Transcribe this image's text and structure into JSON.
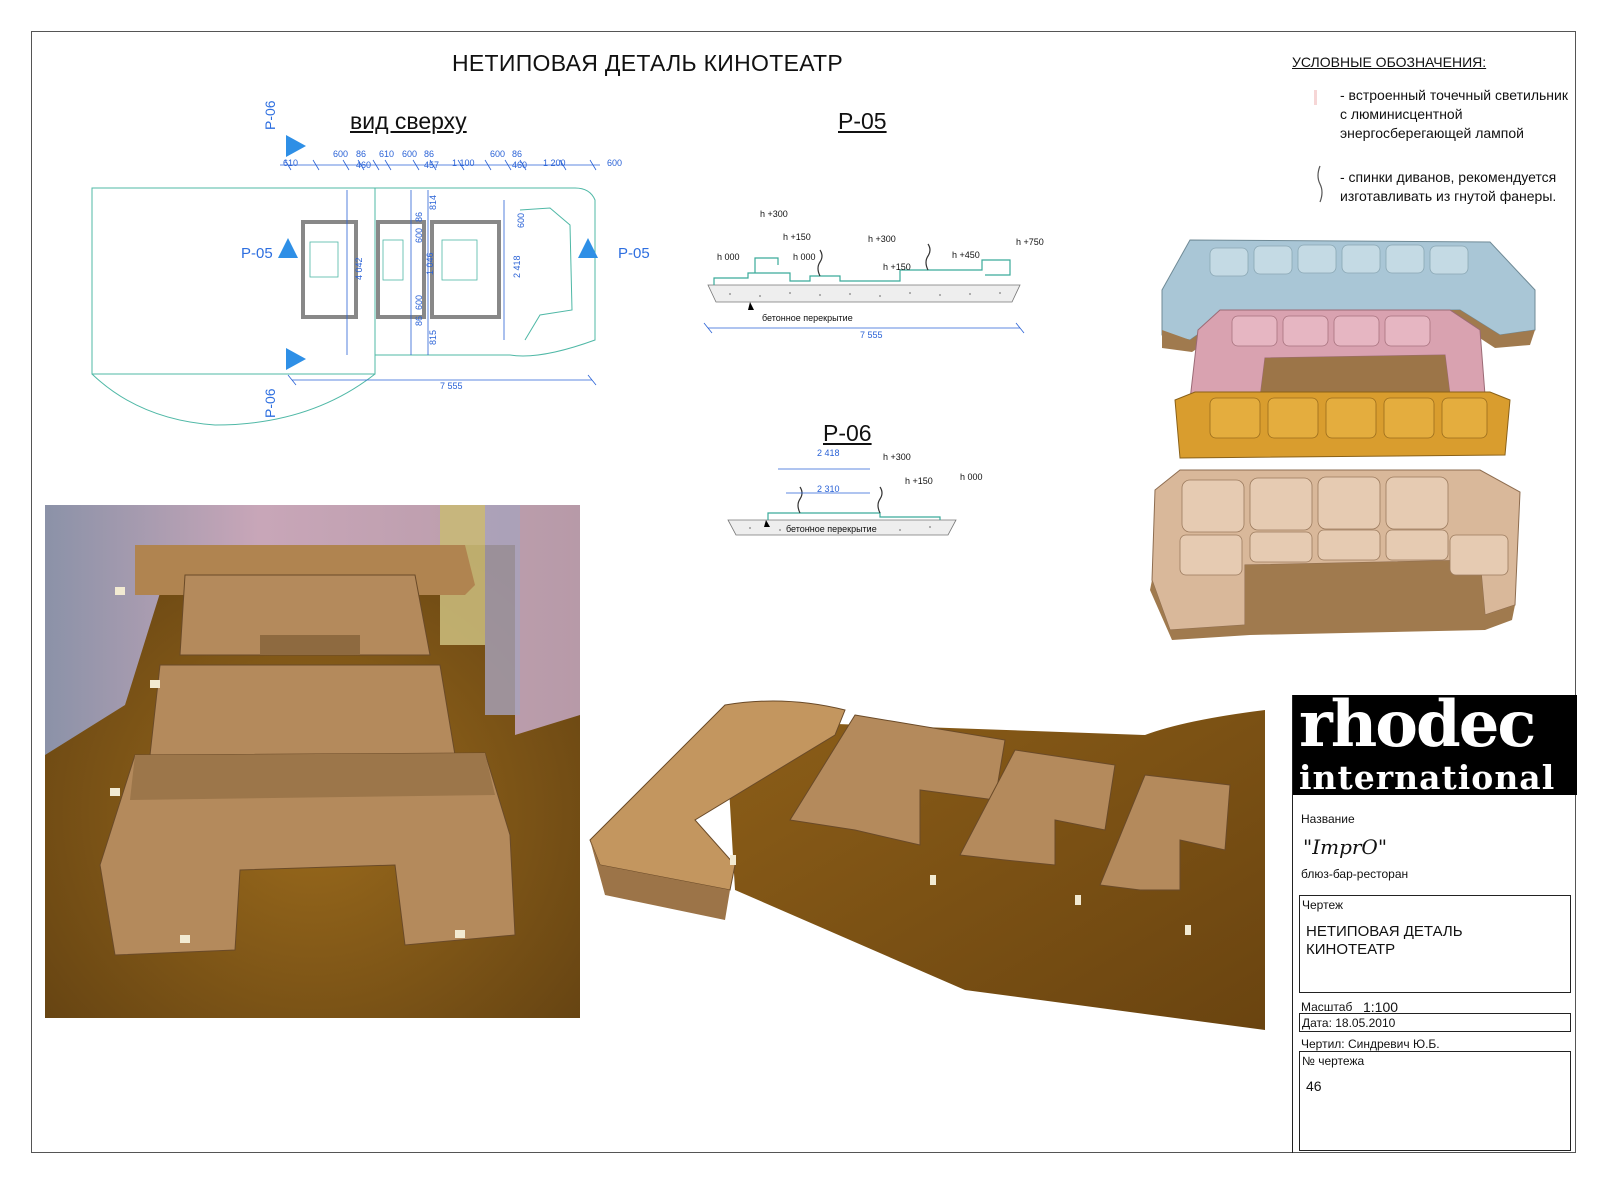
{
  "sheet": {
    "title": "НЕТИПОВАЯ ДЕТАЛЬ КИНОТЕАТР"
  },
  "plan": {
    "heading": "вид сверху",
    "section_markers": [
      "Р-06",
      "Р-05",
      "Р-05",
      "Р-06"
    ],
    "top_dims": [
      "610",
      "600",
      "86",
      "460",
      "610",
      "600",
      "86",
      "457",
      "1 100",
      "600",
      "86",
      "460",
      "1 200",
      "600"
    ],
    "vertical_dims": [
      "4 042",
      "86",
      "600",
      "1 046",
      "600",
      "86",
      "814",
      "815",
      "2 418",
      "600"
    ],
    "overall": "7 555"
  },
  "section_p05": {
    "heading": "Р-05",
    "levels": [
      "h 000",
      "h +300",
      "h +150",
      "h 000",
      "h +300",
      "h +150",
      "h +450",
      "h +750"
    ],
    "slab_label": "бетонное перекрытие",
    "overall": "7 555"
  },
  "section_p06": {
    "heading": "Р-06",
    "dims": [
      "2 418",
      "2 310"
    ],
    "levels": [
      "h +300",
      "h +150",
      "h 000"
    ],
    "slab_label": "бетонное перекрытие"
  },
  "legend": {
    "title": "УСЛОВНЫЕ ОБОЗНАЧЕНИЯ:",
    "items": [
      {
        "text": "- встроенный точечный светильник\nс люминисцентной\nэнергосберегающей лампой",
        "icon": "spotlight-icon"
      },
      {
        "text": "- спинки диванов, рекомендуется\nизготавливать из гнутой фанеры.",
        "icon": "sofa-back-icon"
      }
    ]
  },
  "title_block": {
    "logo_line1": "rhodec",
    "logo_line2": "international",
    "name_label": "Название",
    "project_name": "\"ImprO\"",
    "project_sub": "блюз-бар-ресторан",
    "drawing_label": "Чертеж",
    "drawing_name_1": "НЕТИПОВАЯ ДЕТАЛЬ",
    "drawing_name_2": "КИНОТЕАТР",
    "scale_label": "Масштаб",
    "scale_value": "1:100",
    "date": "Дата: 18.05.2010",
    "drawn_by": "Чертил:   Синдревич Ю.Б.",
    "number_label": "№ чертежа",
    "number_value": "46"
  },
  "colors": {
    "plan_line": "#4fb8a6",
    "dim_line": "#2a62d6",
    "marker": "#2e8fe6",
    "wood": "#b0885c",
    "floor": "#7a5418"
  }
}
